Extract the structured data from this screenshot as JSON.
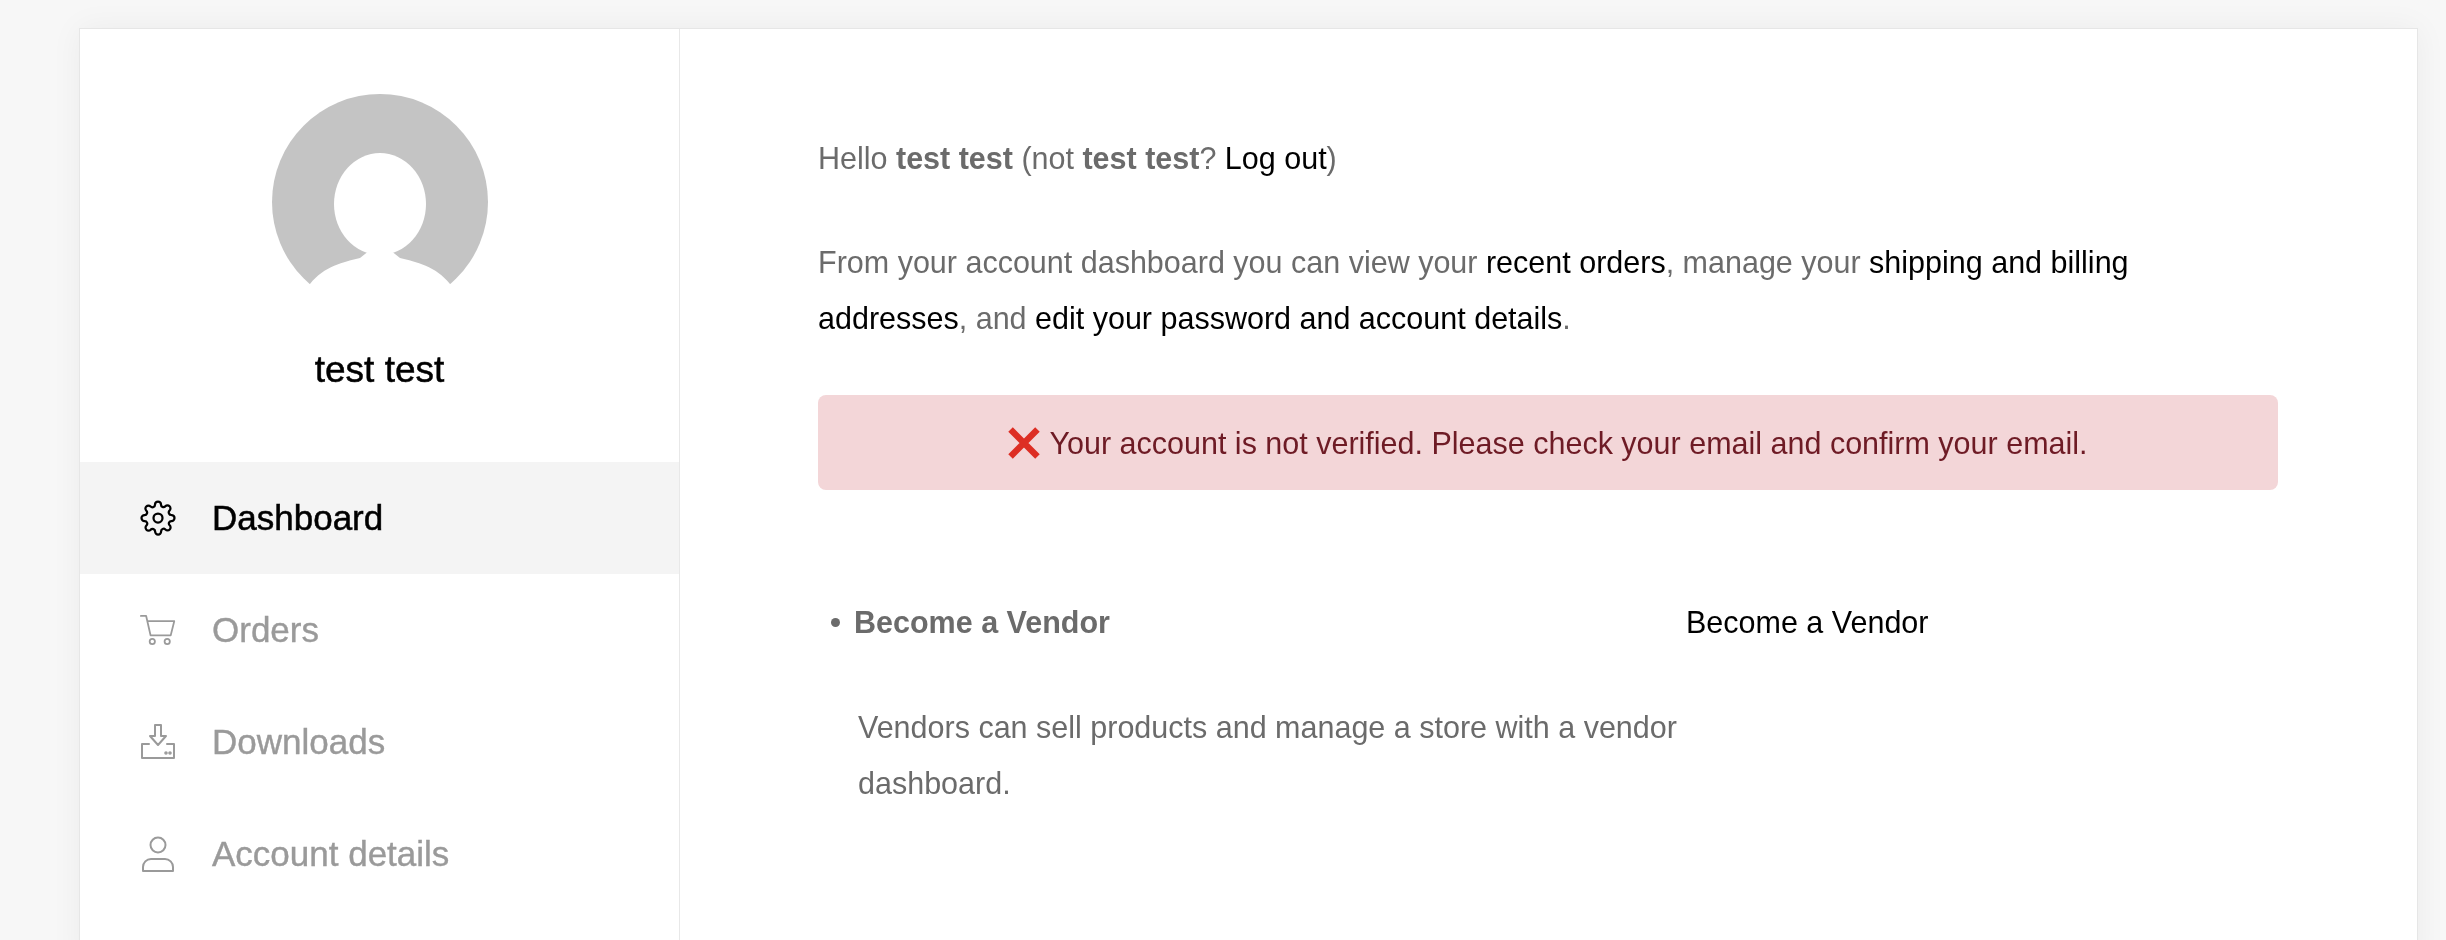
{
  "sidebar": {
    "name": "test test",
    "nav": [
      {
        "label": "Dashboard",
        "selected": true
      },
      {
        "label": "Orders",
        "selected": false
      },
      {
        "label": "Downloads",
        "selected": false
      },
      {
        "label": "Account details",
        "selected": false
      }
    ]
  },
  "main": {
    "greeting": [
      {
        "kind": "text",
        "text": "Hello "
      },
      {
        "kind": "bold",
        "text": "test test"
      },
      {
        "kind": "text",
        "text": " (not "
      },
      {
        "kind": "bold",
        "text": "test test"
      },
      {
        "kind": "text",
        "text": "? "
      },
      {
        "kind": "link",
        "text": "Log out"
      },
      {
        "kind": "text",
        "text": ")"
      }
    ],
    "intro": [
      {
        "kind": "text",
        "text": "From your account dashboard you can view your "
      },
      {
        "kind": "link",
        "text": "recent orders"
      },
      {
        "kind": "text",
        "text": ", manage your "
      },
      {
        "kind": "link",
        "text": "shipping and billing"
      },
      {
        "kind": "link",
        "text": "addresses"
      },
      {
        "kind": "text",
        "text": ", and "
      },
      {
        "kind": "link",
        "text": "edit your password and account details"
      },
      {
        "kind": "text",
        "text": "."
      }
    ],
    "notice": {
      "text": "Your account is not verified. Please check your email and confirm your email."
    },
    "vendor": [
      {
        "title": "Become a Vendor",
        "description": "Vendors can sell products and manage a store with a vendor dashboard.",
        "action": "Become a Vendor"
      }
    ]
  }
}
